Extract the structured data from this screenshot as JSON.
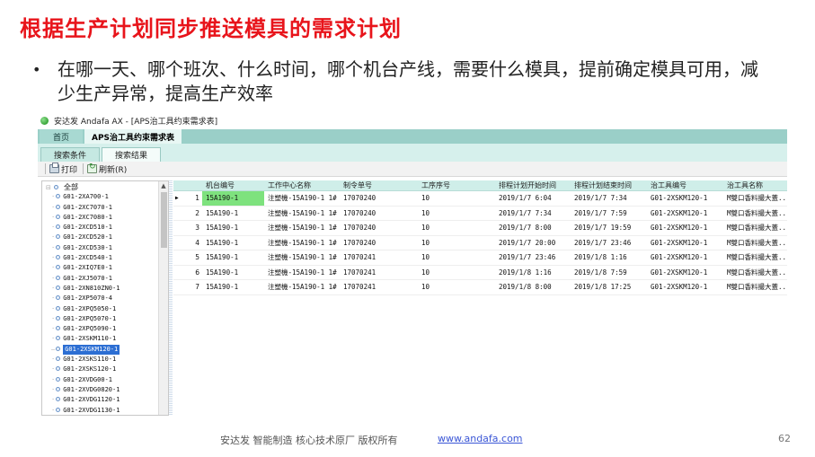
{
  "slide": {
    "title": "根据生产计划同步推送模具的需求计划",
    "bullet": "在哪一天、哪个班次、什么时间，哪个机台产线，需要什么模具，提前确定模具可用，减少生产异常，提高生产效率"
  },
  "app": {
    "window_title": "安达发 Andafa AX - [APS治工具约束需求表]",
    "tabs": [
      {
        "label": "首页"
      },
      {
        "label": "APS治工具约束需求表"
      }
    ],
    "subtabs": [
      {
        "label": "搜索条件"
      },
      {
        "label": "搜索结果"
      }
    ],
    "toolbar": {
      "print_label": "打印",
      "refresh_label": "刷新(R)"
    },
    "tree": {
      "root": "全部",
      "items": [
        "G01-2XA700-1",
        "G01-2XC7070-1",
        "G01-2XC7080-1",
        "G01-2XCD510-1",
        "G01-2XCD520-1",
        "G01-2XCD530-1",
        "G01-2XCD540-1",
        "G01-2XIQ7E0-1",
        "G01-2XJ5070-1",
        "G01-2XN810ZN0-1",
        "G01-2XP5070-4",
        "G01-2XPQ5050-1",
        "G01-2XPQ5070-1",
        "G01-2XPQ5090-1",
        "G01-2XSKM110-1",
        "G01-2XSKM120-1",
        "G01-2XSKS110-1",
        "G01-2XSKS120-1",
        "G01-2XVDG00-1",
        "G01-2XVDG0820-1",
        "G01-2XVDG1120-1",
        "G01-2XVDG1130-1"
      ],
      "selected": "G01-2XSKM120-1"
    },
    "grid": {
      "columns": [
        "机台编号",
        "工作中心名称",
        "制令单号",
        "工序序号",
        "排程计划开始时间",
        "排程计划结束时间",
        "治工具编号",
        "治工具名称"
      ],
      "rows": [
        {
          "no": "1",
          "cells": [
            "15A190-1",
            "注塑機-15A190-1 1#",
            "17070240",
            "10",
            "2019/1/7 6:04",
            "2019/1/7 7:34",
            "G01-2XSKM120-1",
            "M雙口香料撮大蓋..."
          ]
        },
        {
          "no": "2",
          "cells": [
            "15A190-1",
            "注塑機-15A190-1 1#",
            "17070240",
            "10",
            "2019/1/7 7:34",
            "2019/1/7 7:59",
            "G01-2XSKM120-1",
            "M雙口香料撮大蓋..."
          ]
        },
        {
          "no": "3",
          "cells": [
            "15A190-1",
            "注塑機-15A190-1 1#",
            "17070240",
            "10",
            "2019/1/7 8:00",
            "2019/1/7 19:59",
            "G01-2XSKM120-1",
            "M雙口香料撮大蓋..."
          ]
        },
        {
          "no": "4",
          "cells": [
            "15A190-1",
            "注塑機-15A190-1 1#",
            "17070240",
            "10",
            "2019/1/7 20:00",
            "2019/1/7 23:46",
            "G01-2XSKM120-1",
            "M雙口香料撮大蓋..."
          ]
        },
        {
          "no": "5",
          "cells": [
            "15A190-1",
            "注塑機-15A190-1 1#",
            "17070241",
            "10",
            "2019/1/7 23:46",
            "2019/1/8 1:16",
            "G01-2XSKM120-1",
            "M雙口香料撮大蓋..."
          ]
        },
        {
          "no": "6",
          "cells": [
            "15A190-1",
            "注塑機-15A190-1 1#",
            "17070241",
            "10",
            "2019/1/8 1:16",
            "2019/1/8 7:59",
            "G01-2XSKM120-1",
            "M雙口香料撮大蓋..."
          ]
        },
        {
          "no": "7",
          "cells": [
            "15A190-1",
            "注塑機-15A190-1 1#",
            "17070241",
            "10",
            "2019/1/8 8:00",
            "2019/1/8 17:25",
            "G01-2XSKM120-1",
            "M雙口香料撮大蓋..."
          ]
        }
      ],
      "current_row_marker": "▶"
    }
  },
  "footer": {
    "text": "安达发  智能制造 核心技术原厂   版权所有",
    "link": "www.andafa.com",
    "page": "62"
  },
  "colors": {
    "title_red": "#e8141b",
    "tab_teal": "#9acfc8",
    "selected_cell": "#7ee27e",
    "tree_selected": "#2c6ed3",
    "link_blue": "#3a56d6"
  }
}
